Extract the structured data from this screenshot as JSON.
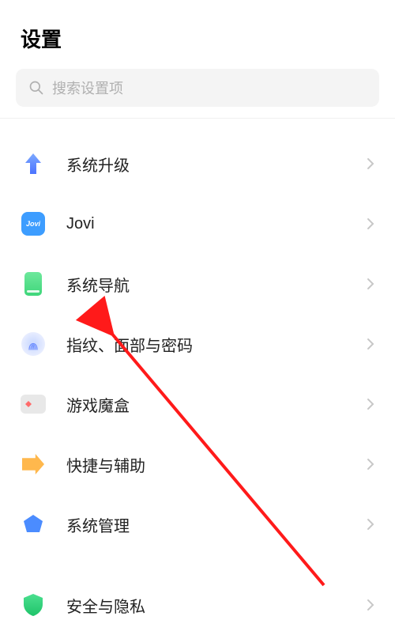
{
  "header": {
    "title": "设置"
  },
  "search": {
    "placeholder": "搜索设置项"
  },
  "items": [
    {
      "id": "system-upgrade",
      "label": "系统升级"
    },
    {
      "id": "jovi",
      "label": "Jovi"
    },
    {
      "id": "system-navigation",
      "label": "系统导航"
    },
    {
      "id": "fingerprint-face-password",
      "label": "指纹、面部与密码"
    },
    {
      "id": "game-box",
      "label": "游戏魔盒"
    },
    {
      "id": "shortcut-accessibility",
      "label": "快捷与辅助"
    },
    {
      "id": "system-management",
      "label": "系统管理"
    },
    {
      "id": "security-privacy",
      "label": "安全与隐私"
    }
  ],
  "colors": {
    "accent_blue": "#4b8cff",
    "arrow_red": "#ff1a1a"
  }
}
